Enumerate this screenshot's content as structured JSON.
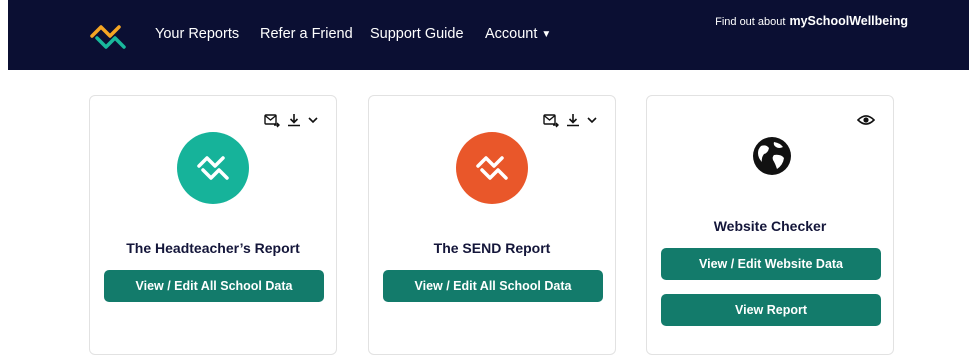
{
  "nav": {
    "links": [
      "Your Reports",
      "Refer a Friend",
      "Support Guide",
      "Account"
    ],
    "find_out_text": "Find out about",
    "brand": "mySchoolWellbeing",
    "account_icon": "chevron-down-icon",
    "logo_icon": "zigzag-logo"
  },
  "cards": [
    {
      "title": "The Headteacher’s Report",
      "button": "View / Edit All School Data",
      "icons": [
        "mail-forward-icon",
        "download-icon",
        "chevron-down-icon"
      ],
      "badge_color": "#16b39a"
    },
    {
      "title": "The SEND Report",
      "button": "View / Edit All School Data",
      "icons": [
        "mail-forward-icon",
        "download-icon",
        "chevron-down-icon"
      ],
      "badge_color": "#e9572a"
    },
    {
      "title": "Website Checker",
      "button": "View / Edit Website Data",
      "button2": "View Report",
      "icons": [
        "eye-icon"
      ],
      "badge_icon": "globe-icon"
    }
  ],
  "colors": {
    "navbar": "#0b0f33",
    "button": "#137b6b",
    "logo_orange": "#f5a623",
    "logo_teal": "#19b89c"
  }
}
